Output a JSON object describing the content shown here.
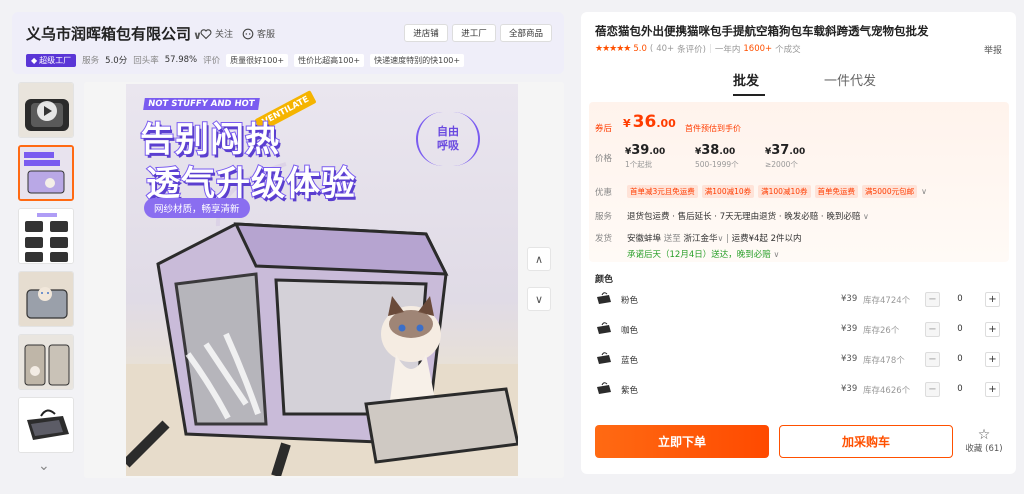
{
  "shop": {
    "name": "义乌市润晖箱包有限公司",
    "follow_label": "关注",
    "service_label": "客服",
    "buttons": [
      "进店铺",
      "进工厂",
      "全部商品"
    ],
    "badge": "超级工厂",
    "service_label2": "服务",
    "service_score": "5.0分",
    "return_label": "回头率",
    "return_rate": "57.98%",
    "review_label": "评价",
    "tags": [
      "质量很好100+",
      "性价比超高100+",
      "快递速度特别的快100+"
    ]
  },
  "main_image": {
    "top_text": "NOT STUFFY AND HOT",
    "ventilate": "VENTILATE",
    "headline1": "告别闷热",
    "headline2": "透气升级体验",
    "sub": "网纱材质，畅享清新",
    "bubble1": "自由",
    "bubble2": "呼吸"
  },
  "product": {
    "title": "蓓恋猫包外出便携猫咪包手提航空箱狗包车载斜跨透气宠物包批发",
    "stars": "★★★★★",
    "score": "5.0",
    "reviews_prefix": "(",
    "reviews_count": "40+",
    "reviews_suffix": "条评价)",
    "sales_prefix": "一年内",
    "sales_count": "1600+",
    "sales_suffix": "个成交",
    "report": "举报",
    "tabs": [
      "批发",
      "一件代发"
    ]
  },
  "pricing": {
    "coupon_label": "券后",
    "coupon_symbol": "¥",
    "coupon_int": "36",
    "coupon_dec": ".00",
    "coupon_note": "首件预估到手价",
    "price_label": "价格",
    "tiers": [
      {
        "sym": "¥",
        "int": "39",
        "dec": ".00",
        "qty": "1个起批"
      },
      {
        "sym": "¥",
        "int": "38",
        "dec": ".00",
        "qty": "500-1999个"
      },
      {
        "sym": "¥",
        "int": "37",
        "dec": ".00",
        "qty": "≥2000个"
      }
    ],
    "promo_label": "优惠",
    "promos": [
      "首单减3元且免运费",
      "满100减10券",
      "满100减10券",
      "首单免运费",
      "满5000元包邮"
    ],
    "service_label": "服务",
    "service_text": "退货包运费 · 售后延长 · 7天无理由退货 · 晚发必赔 · 晚到必赔",
    "ship_label": "发货",
    "ship_from": "安徽蚌埠",
    "ship_to_word": "送至",
    "ship_to": "浙江金华",
    "ship_fee": "运费¥4起",
    "ship_time": "2件以内",
    "ship_promise": "承诺后天（12月4日）送达，晚到必赔"
  },
  "colors": {
    "label": "颜色",
    "items": [
      {
        "name": "粉色",
        "price": "¥39",
        "stock": "库存4724个",
        "qty": "0"
      },
      {
        "name": "咖色",
        "price": "¥39",
        "stock": "库存26个",
        "qty": "0"
      },
      {
        "name": "蓝色",
        "price": "¥39",
        "stock": "库存478个",
        "qty": "0"
      },
      {
        "name": "紫色",
        "price": "¥39",
        "stock": "库存4626个",
        "qty": "0"
      }
    ]
  },
  "actions": {
    "order": "立即下单",
    "cart": "加采购车",
    "fav": "收藏",
    "fav_count": "(61)"
  },
  "colors_theme": {
    "accent": "#ff5000",
    "brand_purple": "#5a36d6"
  }
}
